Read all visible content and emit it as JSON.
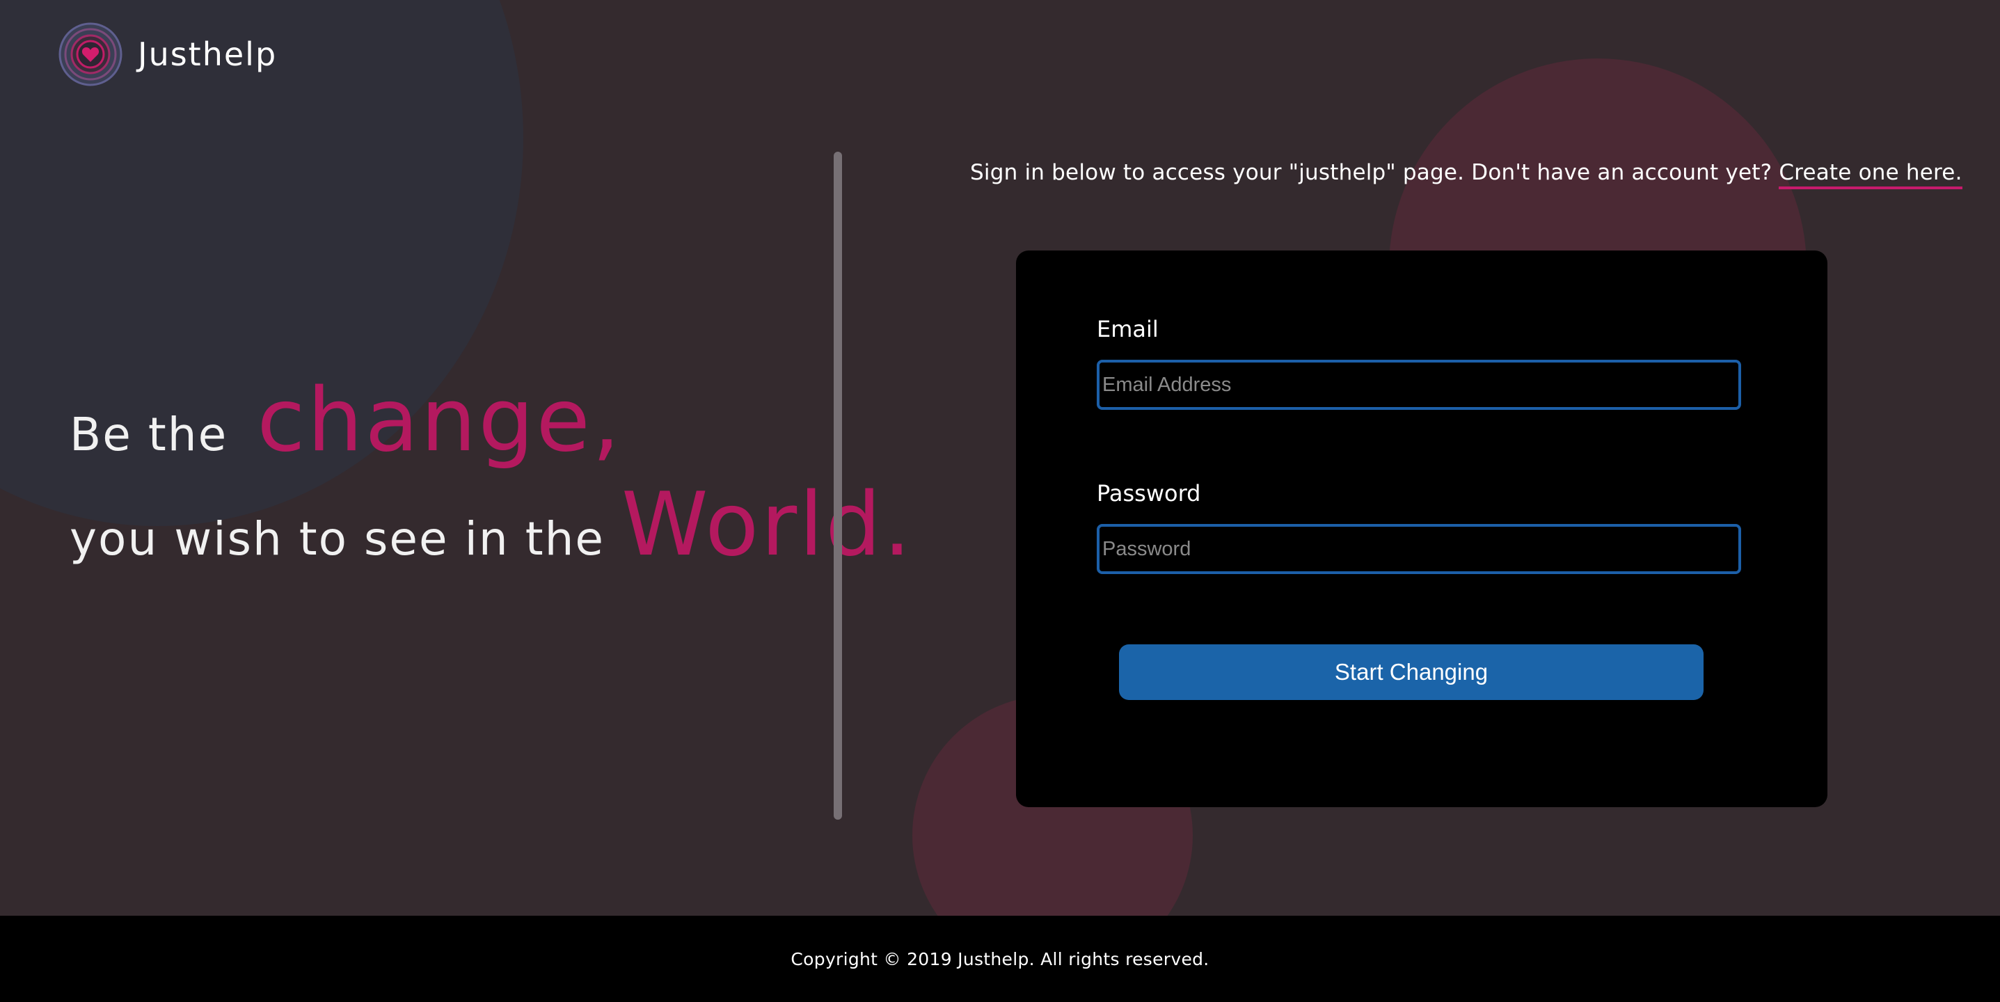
{
  "brand": {
    "name": "Justhelp",
    "logo_icon": "heart-target-icon",
    "accent_color": "#b4195f"
  },
  "hero": {
    "line1_prefix": "Be the",
    "line1_emphasis": "change,",
    "line2_prefix": "you wish to see in the",
    "line2_emphasis": "World."
  },
  "signin": {
    "intro_text": "Sign in below to access your \"justhelp\" page. Don't have an account yet?",
    "create_link": "Create one here.",
    "link_underline_color": "#c61b6c"
  },
  "form": {
    "email_label": "Email",
    "email_placeholder": "Email Address",
    "email_value": "",
    "password_label": "Password",
    "password_placeholder": "Password",
    "password_value": "",
    "submit_label": "Start Changing",
    "submit_color": "#1b64a9"
  },
  "footer": {
    "copyright": "Copyright © 2019 Justhelp. All rights reserved."
  }
}
